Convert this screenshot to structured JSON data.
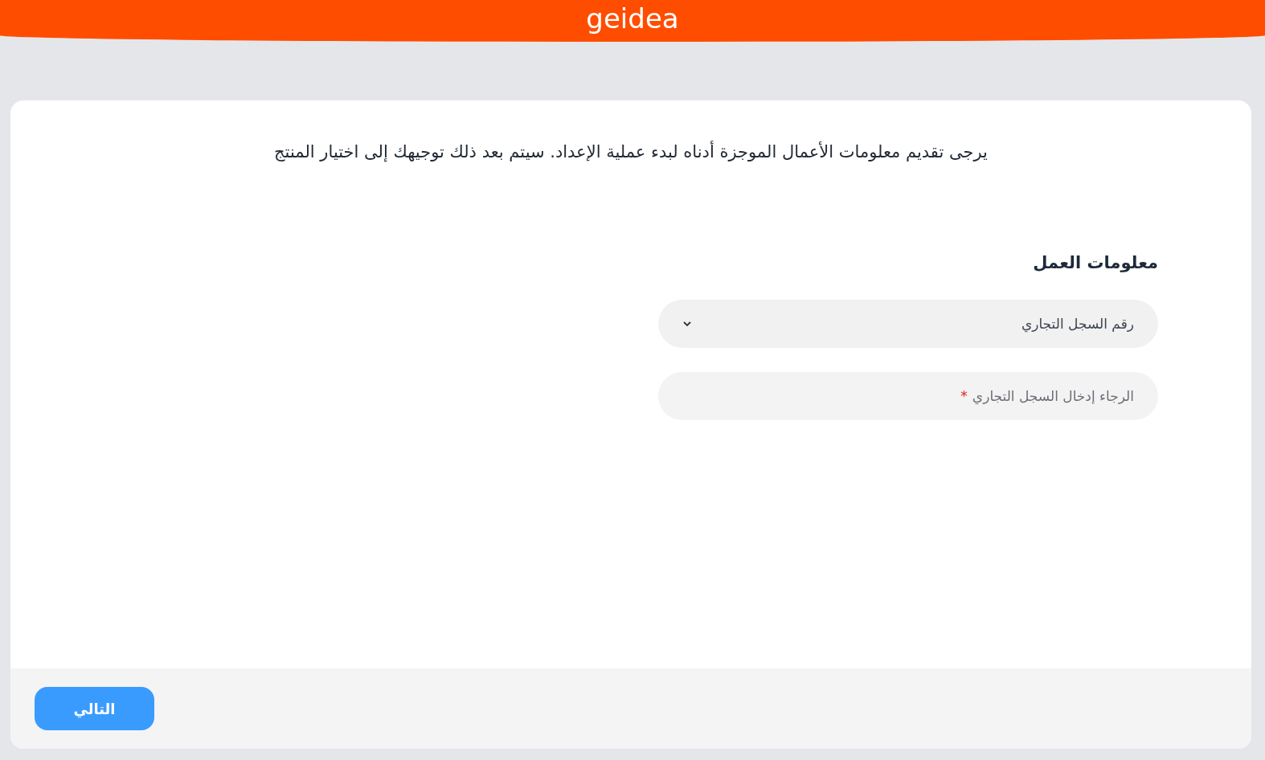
{
  "header": {
    "logo": "geidea"
  },
  "intro": "يرجى تقديم معلومات الأعمال الموجزة أدناه لبدء عملية الإعداد. سيتم بعد ذلك توجيهك إلى اختيار المنتج",
  "section": {
    "title": "معلومات العمل",
    "fields": [
      {
        "kind": "select",
        "value": "رقم السجل التجاري"
      },
      {
        "kind": "text",
        "placeholder": "الرجاء إدخال السجل التجاري",
        "required": true,
        "required_mark": "*"
      }
    ]
  },
  "footer": {
    "next_button": "التالي"
  }
}
